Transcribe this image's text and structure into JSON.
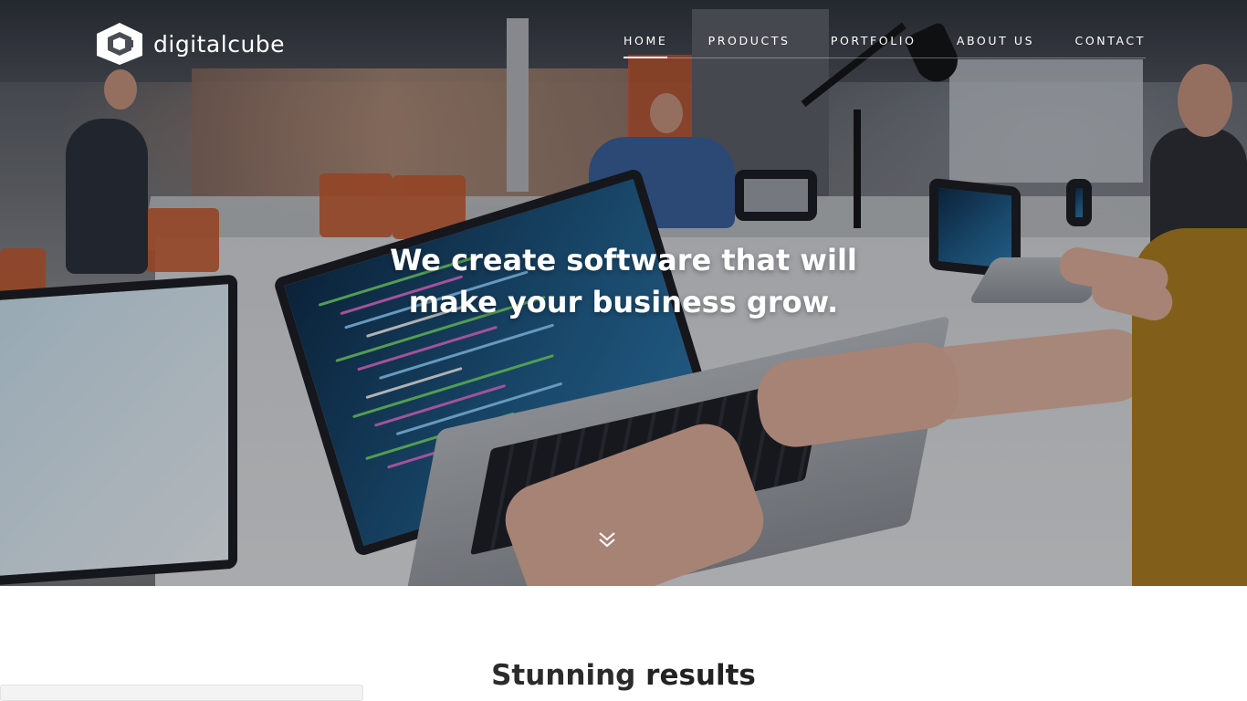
{
  "header": {
    "logo_text": "digitalcube",
    "logo_icon": "hexagon-cube-logo"
  },
  "nav": {
    "items": [
      {
        "label": "HOME",
        "active": true
      },
      {
        "label": "PRODUCTS",
        "active": false
      },
      {
        "label": "PORTFOLIO",
        "active": false
      },
      {
        "label": "ABOUT US",
        "active": false
      },
      {
        "label": "CONTACT",
        "active": false
      }
    ]
  },
  "hero": {
    "headline_line1": "We create software that will",
    "headline_line2": "make your business grow.",
    "scroll_icon": "double-chevron-down-icon"
  },
  "section": {
    "title_light": "Stunning",
    "title_bold": "results"
  },
  "colors": {
    "text_primary": "#ffffff",
    "section_title": "#2b2b2b",
    "page_background": "#ffffff"
  }
}
